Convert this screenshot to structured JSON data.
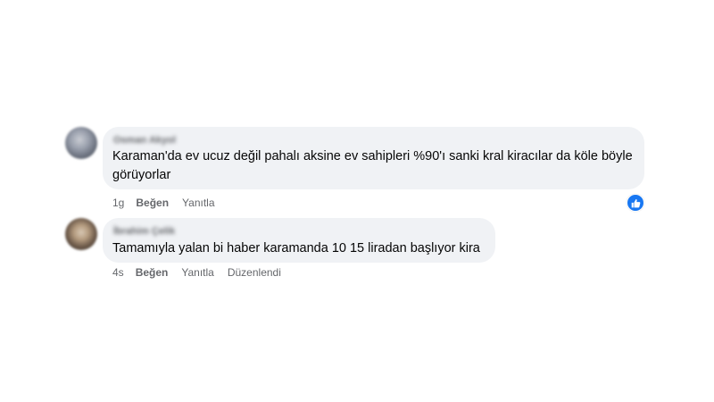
{
  "comments": [
    {
      "author": "Osman Akyol",
      "text": "Karaman'da ev ucuz değil pahalı aksine ev sahipleri %90'ı sanki kral kiracılar da köle böyle görüyorlar",
      "time": "1g",
      "like_label": "Beğen",
      "reply_label": "Yanıtla",
      "reaction_icon": "thumbs-up-icon"
    },
    {
      "author": "İbrahim Çelik",
      "text": "Tamamıyla yalan bi haber karamanda 10 15 liradan başlıyor kira",
      "time": "4s",
      "like_label": "Beğen",
      "reply_label": "Yanıtla",
      "edited_label": "Düzenlendi"
    }
  ],
  "colors": {
    "bubble_bg": "#f0f2f5",
    "secondary_text": "#65676b",
    "primary_text": "#050505",
    "like_blue": "#1877f2"
  }
}
